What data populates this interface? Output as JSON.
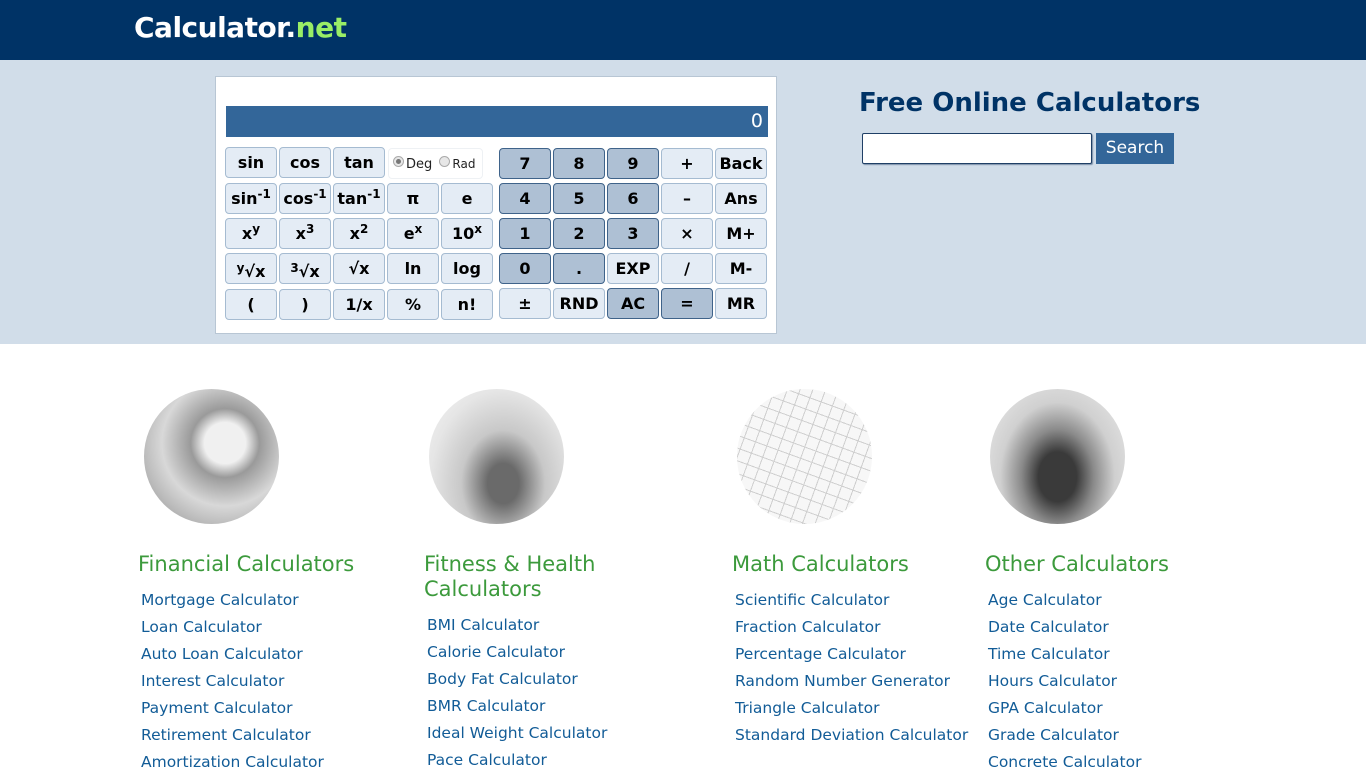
{
  "header": {
    "logo_main": "Calculator",
    "logo_dot": ".",
    "logo_tld": "net",
    "colors": {
      "header_bg": "#003366",
      "tld": "#99ee66"
    }
  },
  "calculator": {
    "display_value": "0",
    "angle_mode": {
      "options": [
        "Deg",
        "Rad"
      ],
      "selected": "Deg"
    },
    "scientific_buttons": [
      [
        "sin",
        "cos",
        "tan"
      ],
      [
        "sin⁻¹",
        "cos⁻¹",
        "tan⁻¹",
        "π",
        "e"
      ],
      [
        "xʸ",
        "x³",
        "x²",
        "eˣ",
        "10ˣ"
      ],
      [
        "ʸ√x",
        "³√x",
        "√x",
        "ln",
        "log"
      ],
      [
        "(",
        ")",
        "1/x",
        "%",
        "n!"
      ]
    ],
    "number_buttons": [
      [
        "7",
        "8",
        "9",
        "+",
        "Back"
      ],
      [
        "4",
        "5",
        "6",
        "–",
        "Ans"
      ],
      [
        "1",
        "2",
        "3",
        "×",
        "M+"
      ],
      [
        "0",
        ".",
        "EXP",
        "/",
        "M-"
      ],
      [
        "±",
        "RND",
        "AC",
        "=",
        "MR"
      ]
    ]
  },
  "search": {
    "title": "Free Online Calculators",
    "input_value": "",
    "button_label": "Search"
  },
  "categories": [
    {
      "title": "Financial Calculators",
      "image": "coins-chart-photo",
      "links": [
        "Mortgage Calculator",
        "Loan Calculator",
        "Auto Loan Calculator",
        "Interest Calculator",
        "Payment Calculator",
        "Retirement Calculator",
        "Amortization Calculator"
      ]
    },
    {
      "title": "Fitness & Health Calculators",
      "image": "fitness-food-photo",
      "links": [
        "BMI Calculator",
        "Calorie Calculator",
        "Body Fat Calculator",
        "BMR Calculator",
        "Ideal Weight Calculator",
        "Pace Calculator"
      ]
    },
    {
      "title": "Math Calculators",
      "image": "math-equation-photo",
      "links": [
        "Scientific Calculator",
        "Fraction Calculator",
        "Percentage Calculator",
        "Random Number Generator",
        "Triangle Calculator",
        "Standard Deviation Calculator"
      ]
    },
    {
      "title": "Other Calculators",
      "image": "fuel-pump-photo",
      "links": [
        "Age Calculator",
        "Date Calculator",
        "Time Calculator",
        "Hours Calculator",
        "GPA Calculator",
        "Grade Calculator",
        "Concrete Calculator"
      ]
    }
  ]
}
